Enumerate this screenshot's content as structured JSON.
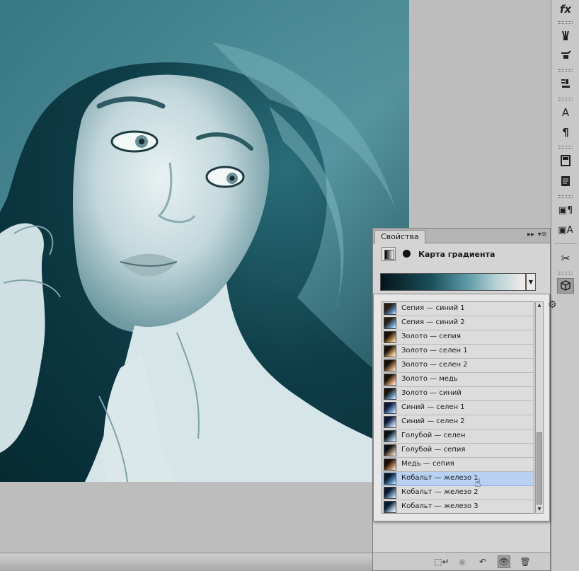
{
  "properties_panel": {
    "tab_label": "Свойства",
    "collapse_icon": "double-chevron-right-icon",
    "menu_icon": "panel-menu-icon",
    "adjustment_title": "Карта градиента",
    "gradient_preview_colors": [
      "#061418",
      "#1a4f5c",
      "#5d9aa8",
      "#b7d2d6",
      "#f3ecec"
    ]
  },
  "gradient_picker": {
    "items": [
      {
        "label": "Сепия — синий 1",
        "c1": "#2a1d12",
        "c2": "#4f8bbd"
      },
      {
        "label": "Сепия — синий 2",
        "c1": "#2a1d12",
        "c2": "#6aa2cf"
      },
      {
        "label": "Золото — сепия",
        "c1": "#1a1208",
        "c2": "#c89a5a"
      },
      {
        "label": "Золото — селен 1",
        "c1": "#1a1208",
        "c2": "#d9b07a"
      },
      {
        "label": "Золото — селен 2",
        "c1": "#1a1208",
        "c2": "#c59a6a"
      },
      {
        "label": "Золото — медь",
        "c1": "#1a1208",
        "c2": "#d8a27a"
      },
      {
        "label": "Золото — синий",
        "c1": "#1a1208",
        "c2": "#6a9fd0"
      },
      {
        "label": "Синий — селен 1",
        "c1": "#0d1a35",
        "c2": "#7aa6d6"
      },
      {
        "label": "Синий — селен 2",
        "c1": "#0d1a35",
        "c2": "#a3b8d4"
      },
      {
        "label": "Голубой — селен",
        "c1": "#0a1015",
        "c2": "#8fb3cc"
      },
      {
        "label": "Голубой — сепия",
        "c1": "#0a1015",
        "c2": "#b9a38a"
      },
      {
        "label": "Медь — сепия",
        "c1": "#1a0e08",
        "c2": "#c48a66"
      },
      {
        "label": "Кобальт — железо 1",
        "c1": "#081a2e",
        "c2": "#5d8fbf"
      },
      {
        "label": "Кобальт — железо 2",
        "c1": "#081a2e",
        "c2": "#7fa5c9"
      },
      {
        "label": "Кобальт — железо 3",
        "c1": "#081a2e",
        "c2": "#a9c3d9"
      }
    ],
    "selected_label": "Кобальт — железо 1",
    "gear_icon": "gear-icon"
  },
  "right_dock": {
    "buttons": [
      "fx-icon",
      "brush-presets-icon",
      "clone-source-icon",
      "stamp-icon",
      "character-icon",
      "paragraph-icon",
      "book-icon",
      "notes-icon",
      "paragraph-styles-icon",
      "character-styles-icon",
      "tool-presets-icon",
      "3d-icon"
    ],
    "labels": {
      "character": "A",
      "paragraph": "¶"
    }
  },
  "footer_icons": [
    "clip-to-layer-icon",
    "view-previous-icon",
    "reset-icon",
    "visibility-icon",
    "trash-icon"
  ]
}
